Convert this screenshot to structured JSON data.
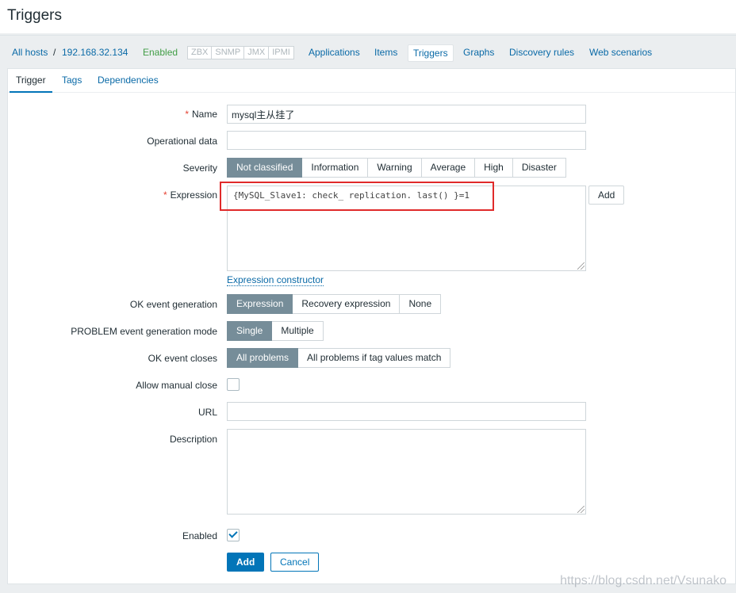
{
  "page_title": "Triggers",
  "host_nav": {
    "all_hosts": "All hosts",
    "separator": "/",
    "host_ip": "192.168.32.134",
    "status": "Enabled",
    "protocols": [
      "ZBX",
      "SNMP",
      "JMX",
      "IPMI"
    ],
    "links": {
      "applications": "Applications",
      "items": "Items",
      "triggers": "Triggers",
      "graphs": "Graphs",
      "discovery_rules": "Discovery rules",
      "web_scenarios": "Web scenarios"
    }
  },
  "tabs": {
    "trigger": "Trigger",
    "tags": "Tags",
    "dependencies": "Dependencies"
  },
  "form": {
    "required_mark": "*",
    "name_label": "Name",
    "name_value": "mysql主从挂了",
    "operational_data_label": "Operational data",
    "operational_data_value": "",
    "severity_label": "Severity",
    "severity_options": [
      "Not classified",
      "Information",
      "Warning",
      "Average",
      "High",
      "Disaster"
    ],
    "severity_selected": "Not classified",
    "expression_label": "Expression",
    "expression_value": "{MySQL_Slave1: check_ replication. last() }=1",
    "expression_add": "Add",
    "expression_constructor": "Expression constructor",
    "ok_event_generation_label": "OK event generation",
    "ok_event_generation_options": [
      "Expression",
      "Recovery expression",
      "None"
    ],
    "problem_mode_label": "PROBLEM event generation mode",
    "problem_mode_options": [
      "Single",
      "Multiple"
    ],
    "ok_event_closes_label": "OK event closes",
    "ok_event_closes_options": [
      "All problems",
      "All problems if tag values match"
    ],
    "allow_manual_close_label": "Allow manual close",
    "allow_manual_close_checked": false,
    "url_label": "URL",
    "url_value": "",
    "description_label": "Description",
    "description_value": "",
    "enabled_label": "Enabled",
    "enabled_checked": true,
    "add_button": "Add",
    "cancel_button": "Cancel"
  },
  "watermark": "https://blog.csdn.net/Vsunako",
  "colors": {
    "link": "#0a6aa7",
    "primary": "#0275b8",
    "selected_segment": "#768d99",
    "enabled_status": "#429e47",
    "required": "#e54233",
    "highlight_box": "#e02a2a"
  }
}
